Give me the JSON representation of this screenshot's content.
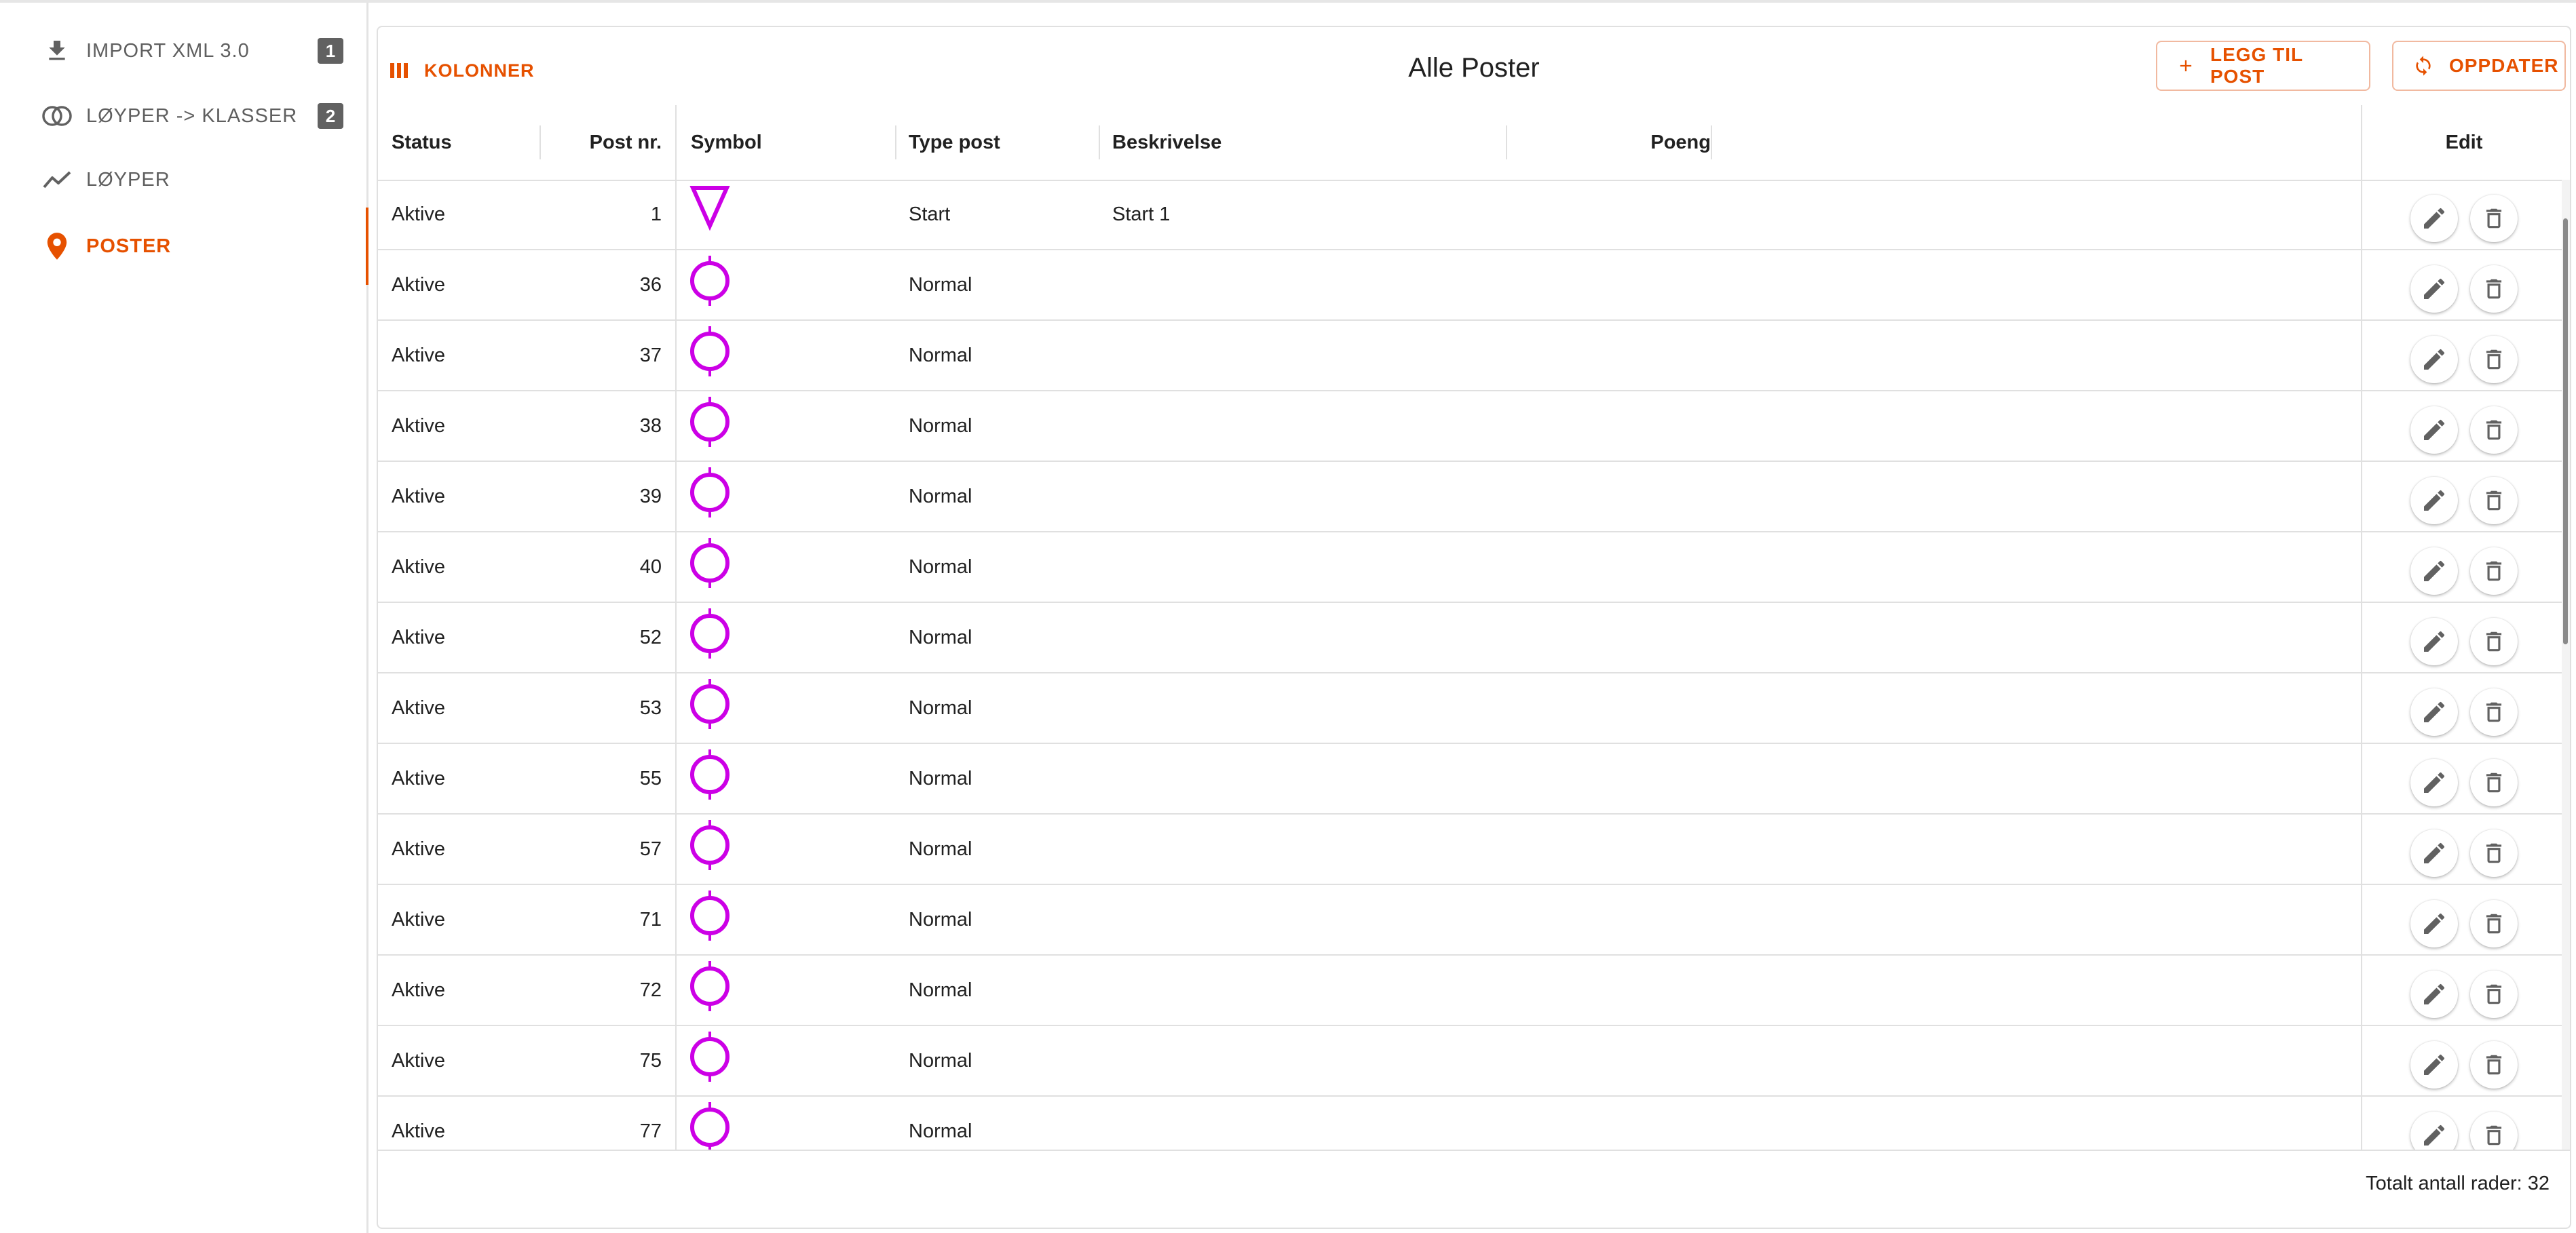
{
  "sidebar": {
    "items": [
      {
        "label": "IMPORT XML 3.0",
        "icon": "download-icon",
        "step": "1"
      },
      {
        "label": "LØYPER -> KLASSER",
        "icon": "link-circles-icon",
        "step": "2"
      },
      {
        "label": "LØYPER",
        "icon": "trending-icon",
        "step": ""
      },
      {
        "label": "POSTER",
        "icon": "location-pin-icon",
        "step": ""
      }
    ],
    "active": "POSTER"
  },
  "toolbar": {
    "columns_label": "KOLONNER",
    "title": "Alle Poster",
    "add_label": "LEGG TIL POST",
    "refresh_label": "OPPDATER"
  },
  "table": {
    "headers": {
      "status": "Status",
      "post_nr": "Post nr.",
      "symbol": "Symbol",
      "type": "Type post",
      "description": "Beskrivelse",
      "points": "Poeng",
      "edit": "Edit"
    },
    "rows": [
      {
        "status": "Aktive",
        "post_nr": "1",
        "symbol": "start-triangle",
        "type": "Start",
        "description": "Start 1",
        "points": ""
      },
      {
        "status": "Aktive",
        "post_nr": "36",
        "symbol": "control-circle",
        "type": "Normal",
        "description": "",
        "points": ""
      },
      {
        "status": "Aktive",
        "post_nr": "37",
        "symbol": "control-circle",
        "type": "Normal",
        "description": "",
        "points": ""
      },
      {
        "status": "Aktive",
        "post_nr": "38",
        "symbol": "control-circle",
        "type": "Normal",
        "description": "",
        "points": ""
      },
      {
        "status": "Aktive",
        "post_nr": "39",
        "symbol": "control-circle",
        "type": "Normal",
        "description": "",
        "points": ""
      },
      {
        "status": "Aktive",
        "post_nr": "40",
        "symbol": "control-circle",
        "type": "Normal",
        "description": "",
        "points": ""
      },
      {
        "status": "Aktive",
        "post_nr": "52",
        "symbol": "control-circle",
        "type": "Normal",
        "description": "",
        "points": ""
      },
      {
        "status": "Aktive",
        "post_nr": "53",
        "symbol": "control-circle",
        "type": "Normal",
        "description": "",
        "points": ""
      },
      {
        "status": "Aktive",
        "post_nr": "55",
        "symbol": "control-circle",
        "type": "Normal",
        "description": "",
        "points": ""
      },
      {
        "status": "Aktive",
        "post_nr": "57",
        "symbol": "control-circle",
        "type": "Normal",
        "description": "",
        "points": ""
      },
      {
        "status": "Aktive",
        "post_nr": "71",
        "symbol": "control-circle",
        "type": "Normal",
        "description": "",
        "points": ""
      },
      {
        "status": "Aktive",
        "post_nr": "72",
        "symbol": "control-circle",
        "type": "Normal",
        "description": "",
        "points": ""
      },
      {
        "status": "Aktive",
        "post_nr": "75",
        "symbol": "control-circle",
        "type": "Normal",
        "description": "",
        "points": ""
      },
      {
        "status": "Aktive",
        "post_nr": "77",
        "symbol": "control-circle",
        "type": "Normal",
        "description": "",
        "points": ""
      }
    ]
  },
  "footer": {
    "total_label": "Totalt antall rader: 32"
  },
  "colors": {
    "accent": "#e65100",
    "symbol": "#cc00e6",
    "icon_grey": "#616161"
  }
}
